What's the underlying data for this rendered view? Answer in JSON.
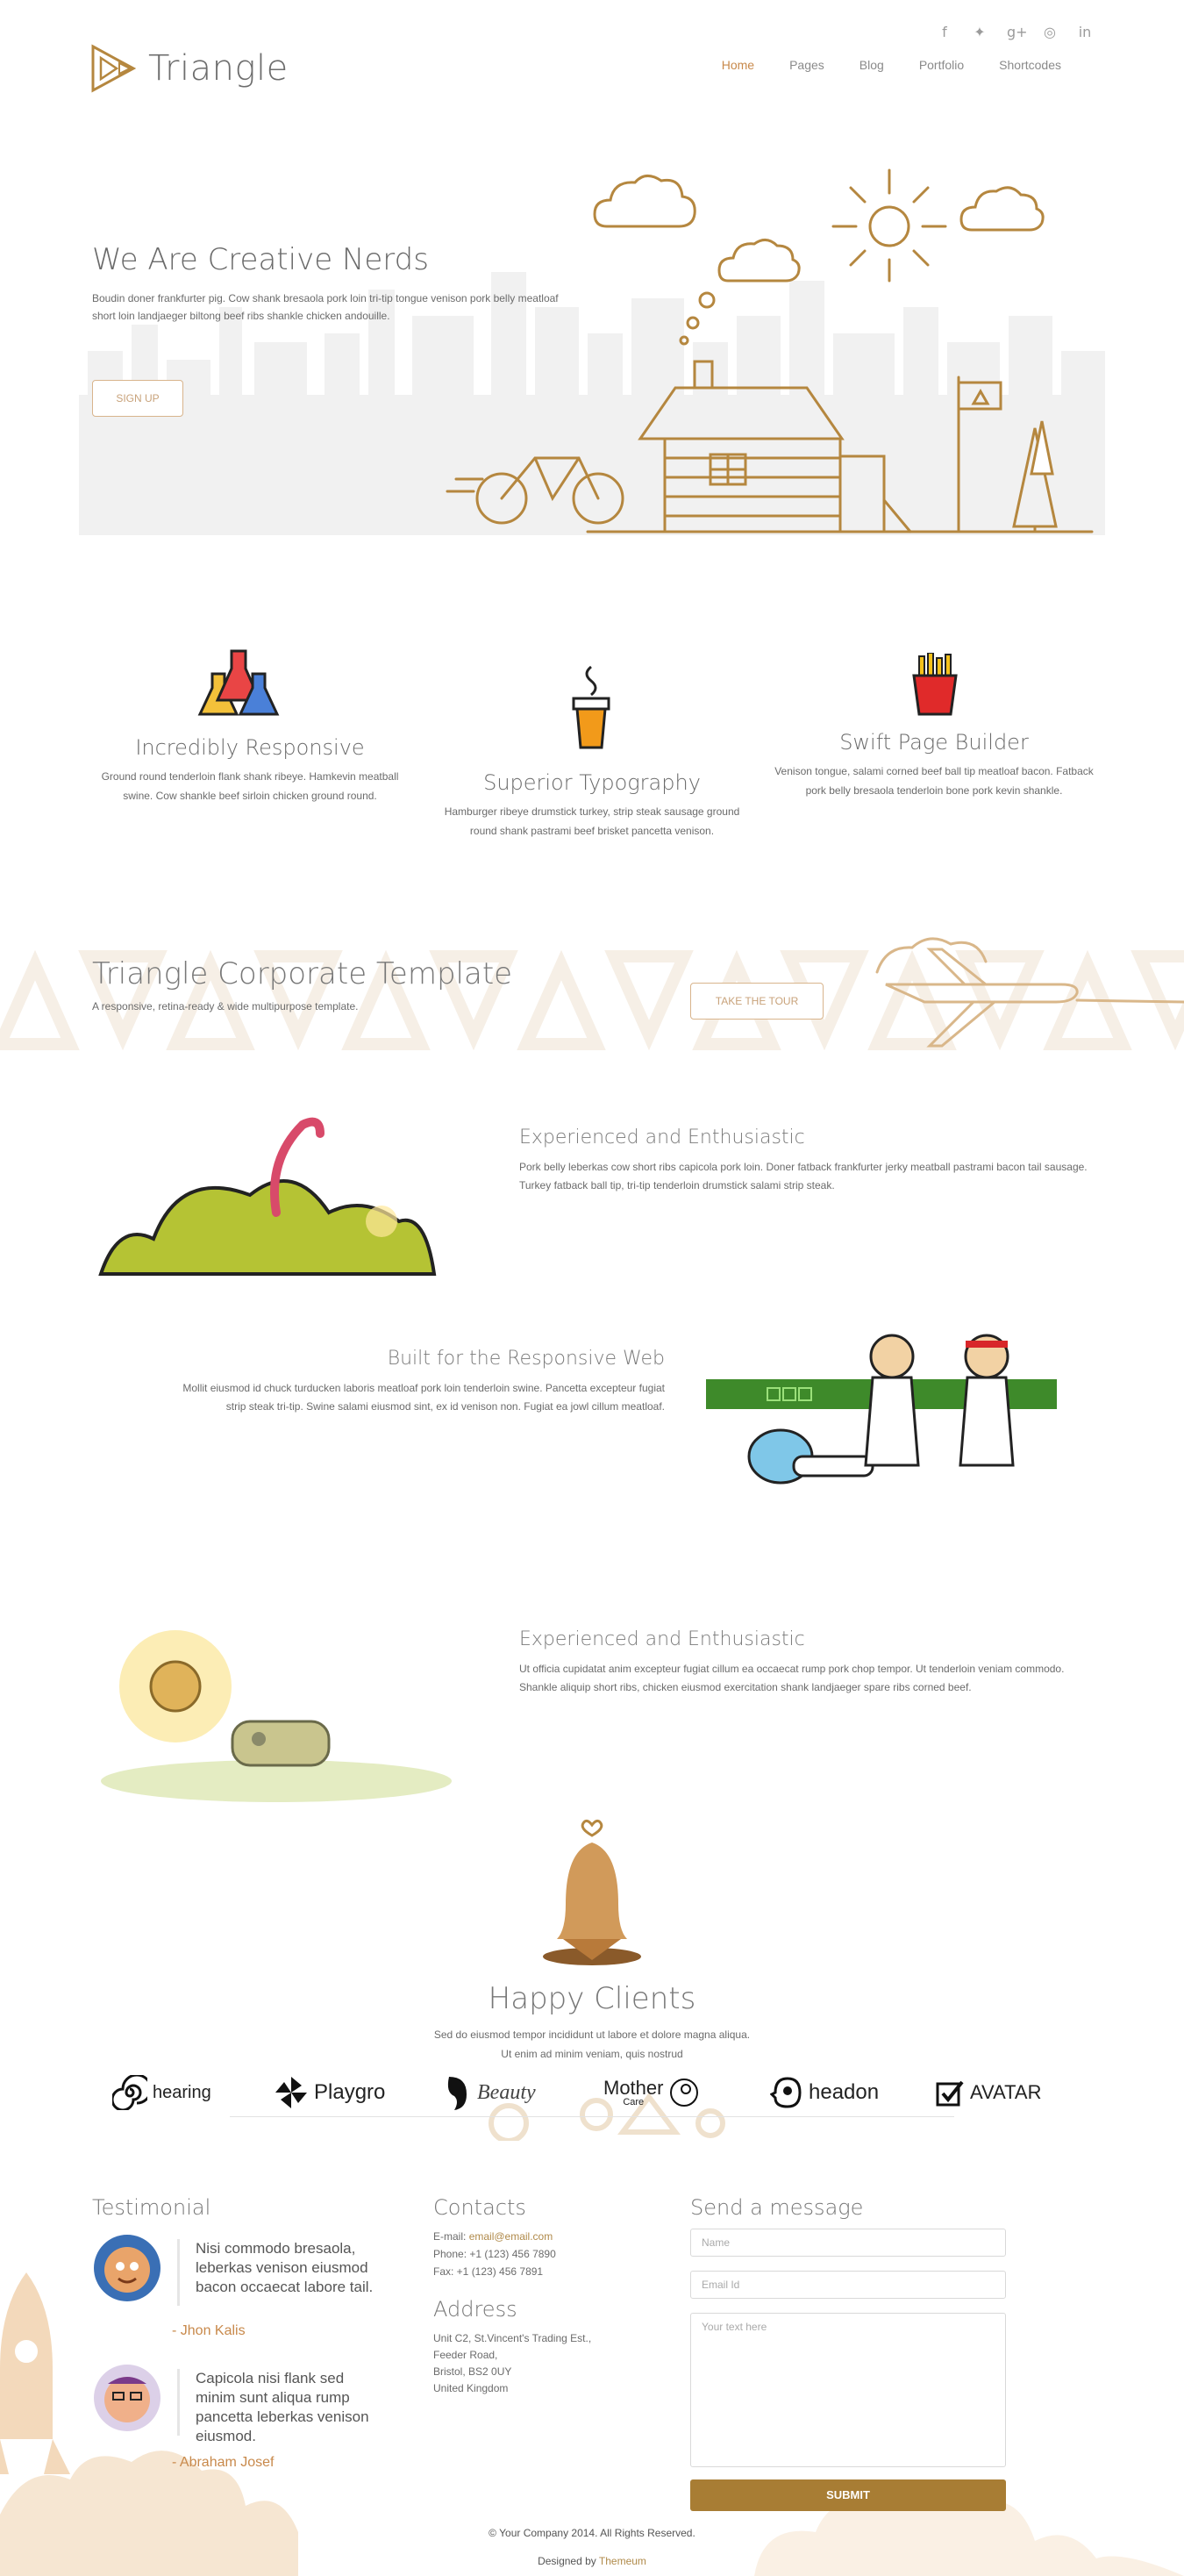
{
  "header": {
    "logo_text": "Triangle",
    "social_icons": [
      "facebook-icon",
      "twitter-icon",
      "google-plus-icon",
      "dribbble-icon",
      "linkedin-icon"
    ],
    "nav": [
      {
        "label": "Home",
        "active": true
      },
      {
        "label": "Pages",
        "active": false
      },
      {
        "label": "Blog",
        "active": false
      },
      {
        "label": "Portfolio",
        "active": false
      },
      {
        "label": "Shortcodes",
        "active": false
      }
    ]
  },
  "hero": {
    "title": "We Are Creative Nerds",
    "text": "Boudin doner frankfurter pig. Cow shank bresaola pork loin tri-tip tongue venison pork belly meatloaf short loin landjaeger biltong beef ribs shankle chicken andouille.",
    "button": "SIGN UP"
  },
  "features": [
    {
      "title": "Incredibly Responsive",
      "text": "Ground round tenderloin flank shank ribeye. Hamkevin meatball swine. Cow shankle beef sirloin chicken ground round."
    },
    {
      "title": "Superior Typography",
      "text": "Hamburger ribeye drumstick turkey, strip steak sausage ground round shank pastrami beef brisket pancetta venison."
    },
    {
      "title": "Swift Page Builder",
      "text": "Venison tongue, salami corned beef ball tip meatloaf bacon. Fatback pork belly bresaola tenderloin bone pork kevin shankle."
    }
  ],
  "band": {
    "title": "Triangle Corporate Template",
    "subtitle": "A responsive, retina-ready & wide multipurpose template.",
    "button": "TAKE THE TOUR"
  },
  "sections": [
    {
      "title": "Experienced and Enthusiastic",
      "text": "Pork belly leberkas cow short ribs capicola pork loin. Doner fatback frankfurter jerky meatball pastrami bacon tail sausage. Turkey fatback ball tip, tri-tip tenderloin drumstick salami strip steak."
    },
    {
      "title": "Built for the Responsive Web",
      "text": "Mollit eiusmod id chuck turducken laboris meatloaf pork loin tenderloin swine. Pancetta excepteur fugiat strip steak tri-tip. Swine salami eiusmod sint, ex id venison non. Fugiat ea jowl cillum meatloaf."
    },
    {
      "title": "Experienced and Enthusiastic",
      "text": "Ut officia cupidatat anim excepteur fugiat cillum ea occaecat rump pork chop tempor. Ut tenderloin veniam commodo. Shankle aliquip short ribs, chicken eiusmod exercitation shank landjaeger spare ribs corned beef."
    }
  ],
  "clients": {
    "title": "Happy Clients",
    "text_line1": "Sed do eiusmod tempor incididunt ut labore et dolore magna aliqua.",
    "text_line2": "Ut enim ad minim veniam, quis nostrud",
    "logos": [
      "hearing",
      "Playgro",
      "Beauty",
      "Mother",
      "headon",
      "AVATAR"
    ],
    "mother_sub": "Care"
  },
  "testimonial": {
    "title": "Testimonial",
    "items": [
      {
        "quote": "Nisi commodo bresaola, leberkas venison eiusmod bacon occaecat labore tail.",
        "author": "- Jhon Kalis"
      },
      {
        "quote": "Capicola nisi flank sed minim sunt aliqua rump pancetta leberkas venison eiusmod.",
        "author": "- Abraham Josef"
      }
    ]
  },
  "contacts": {
    "title": "Contacts",
    "email_label": "E-mail:",
    "email": "email@email.com",
    "phone": "Phone: +1 (123) 456 7890",
    "fax": "Fax: +1 (123) 456 7891",
    "address_title": "Address",
    "address_lines": [
      "Unit C2, St.Vincent's Trading Est.,",
      "Feeder Road,",
      "Bristol, BS2 0UY",
      "United Kingdom"
    ]
  },
  "message": {
    "title": "Send a message",
    "name_placeholder": "Name",
    "email_placeholder": "Email Id",
    "text_placeholder": "Your text here",
    "submit": "SUBMIT"
  },
  "footer": {
    "copyright": "© Your Company 2014. All Rights Reserved.",
    "designed_by": "Designed by",
    "designer": "Themeum"
  },
  "colors": {
    "accent": "#c8894b",
    "brand_brown": "#a87d34",
    "line_art": "#b5873f"
  }
}
